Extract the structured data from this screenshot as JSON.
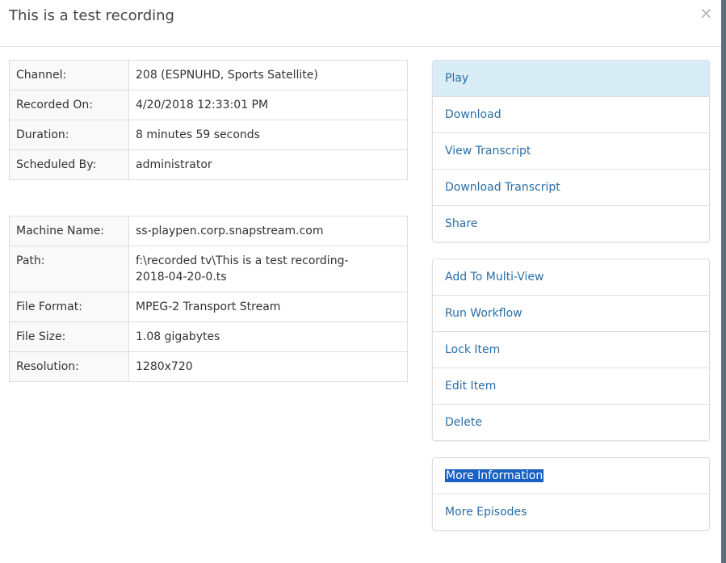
{
  "dialog": {
    "title": "This is a test recording",
    "close_glyph": "×"
  },
  "recording_table": [
    {
      "label": "Channel:",
      "value": "208 (ESPNUHD, Sports Satellite)"
    },
    {
      "label": "Recorded On:",
      "value": "4/20/2018 12:33:01 PM"
    },
    {
      "label": "Duration:",
      "value": "8 minutes 59 seconds"
    },
    {
      "label": "Scheduled By:",
      "value": "administrator"
    }
  ],
  "file_table": [
    {
      "label": "Machine Name:",
      "value": "ss-playpen.corp.snapstream.com"
    },
    {
      "label": "Path:",
      "value_line1": "f:\\recorded tv\\This is a test recording-",
      "value_line2": "2018-04-20-0.ts"
    },
    {
      "label": "File Format:",
      "value": "MPEG-2 Transport Stream"
    },
    {
      "label": "File Size:",
      "value": "1.08 gigabytes"
    },
    {
      "label": "Resolution:",
      "value": "1280x720"
    }
  ],
  "actions_primary": [
    "Play",
    "Download",
    "View Transcript",
    "Download Transcript",
    "Share"
  ],
  "actions_secondary": [
    "Add To Multi-View",
    "Run Workflow",
    "Lock Item",
    "Edit Item",
    "Delete"
  ],
  "actions_more": [
    "More Information",
    "More Episodes"
  ],
  "colors": {
    "link": "#2a6ea8",
    "active_bg": "#d9edf7",
    "selection_bg": "#1a5fc2"
  }
}
